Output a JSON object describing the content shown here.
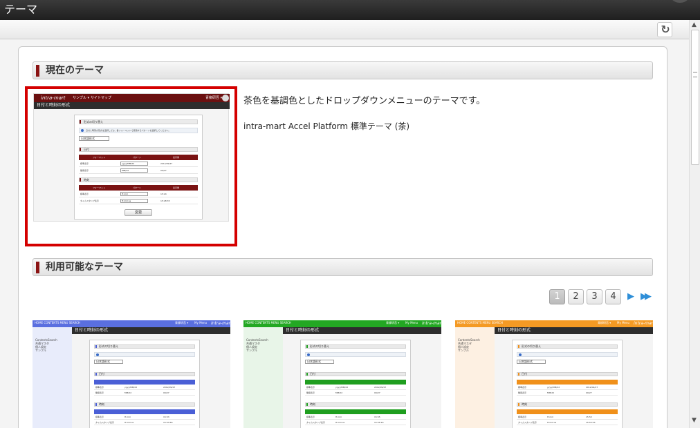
{
  "window": {
    "title": "テーマ"
  },
  "toolbar": {
    "refresh_icon": "refresh-icon",
    "refresh_glyph": "↻"
  },
  "sections": {
    "current": {
      "title": "現在のテーマ"
    },
    "available": {
      "title": "利用可能なテーマ"
    }
  },
  "current_theme": {
    "description": "茶色を基調色としたドロップダウンメニューのテーマです。",
    "name": "intra-mart Accel Platform 標準テーマ (茶)",
    "preview": {
      "logo": "intra-mart",
      "menu_1": "サンプル ▾",
      "menu_2": "サイトマップ",
      "page_title": "日付と時刻の形式",
      "user_menu": "青柳研吾 ▾",
      "section_1": "形式の切り替え",
      "info_text": "日付と時刻の形式を選択しても、各フォーマットで使用するパターンを選択してください。",
      "select_value": "日本語形式",
      "section_2": "日付",
      "section_3": "時刻",
      "table_headers": [
        "フォーマット",
        "パターン",
        "表示例"
      ],
      "date_rows": [
        [
          "標準表示",
          "yyyy/MM/dd",
          "2012/09/27"
        ],
        [
          "簡易表示",
          "MM/dd",
          "09/27"
        ]
      ],
      "time_rows": [
        [
          "標準表示",
          "H:mm",
          "15:24"
        ],
        [
          "タイムスタンプ表示",
          "H:mm:ss",
          "15:28:35"
        ]
      ],
      "button": "変更",
      "accent": "#7a1212"
    }
  },
  "pager": {
    "pages": [
      "1",
      "2",
      "3",
      "4"
    ],
    "active_page": "1",
    "next_icon": "next-arrow-icon",
    "last_icon": "last-arrow-icon",
    "next_glyph": "▶",
    "last_glyph": "▶▶"
  },
  "themes": [
    {
      "accent": "#4a5fd6",
      "sidebar": "#e8ecfb",
      "topbar": "#5a6fe0",
      "top_links": "HOME   CONTENTS   MENU SEARCH",
      "user": "青柳研吾 ▾",
      "my_menu": "My Menu",
      "logo": "intra-mart",
      "page_title": "日付と時刻の形式",
      "side_items": "ContentsSearch\n共通マスタ\n個人設定\nサンプル",
      "section_1": "形式の切り替え",
      "section_2": "日付",
      "section_3": "時刻",
      "select_value": "日本語形式",
      "date_rows": [
        [
          "標準表示",
          "yyyy/MM/dd",
          "2012/09/27"
        ],
        [
          "簡易表示",
          "MM/dd",
          "09/27"
        ]
      ],
      "time_rows": [
        [
          "標準表示",
          "H:mm",
          "15:53"
        ],
        [
          "タイムスタンプ表示",
          "H:mm:ss",
          "15:53:56"
        ]
      ]
    },
    {
      "accent": "#1f9e1f",
      "sidebar": "#e8f5e8",
      "topbar": "#23a823",
      "top_links": "HOME   CONTENTS   MENU SEARCH",
      "user": "青柳研吾 ▾",
      "my_menu": "My Menu",
      "logo": "intra-mart",
      "page_title": "日付と時刻の形式",
      "side_items": "ContentsSearch\n共通マスタ\n個人設定\nサンプル",
      "section_1": "形式の切り替え",
      "section_2": "日付",
      "section_3": "時刻",
      "select_value": "日本語形式",
      "date_rows": [
        [
          "標準表示",
          "yyyy/MM/dd",
          "2012/09/27"
        ],
        [
          "簡易表示",
          "MM/dd",
          "09/27"
        ]
      ],
      "time_rows": [
        [
          "標準表示",
          "H:mm",
          "15:55"
        ],
        [
          "タイムスタンプ表示",
          "H:mm:ss",
          "15:55:16"
        ]
      ]
    },
    {
      "accent": "#f0901a",
      "sidebar": "#fdf0e2",
      "topbar": "#f49a24",
      "top_links": "HOME   CONTENTS   MENU SEARCH",
      "user": "青柳研吾 ▾",
      "my_menu": "My Menu",
      "logo": "intra-mart",
      "page_title": "日付と時刻の形式",
      "side_items": "ContentsSearch\n共通マスタ\n個人設定\nサンプル",
      "section_1": "形式の切り替え",
      "section_2": "日付",
      "section_3": "時刻",
      "select_value": "日本語形式",
      "date_rows": [
        [
          "標準表示",
          "yyyy/MM/dd",
          "2012/09/27"
        ],
        [
          "簡易表示",
          "MM/dd",
          "09/27"
        ]
      ],
      "time_rows": [
        [
          "標準表示",
          "H:mm",
          "15:53"
        ],
        [
          "タイムスタンプ表示",
          "H:mm:ss",
          "15:53:53"
        ]
      ]
    }
  ]
}
